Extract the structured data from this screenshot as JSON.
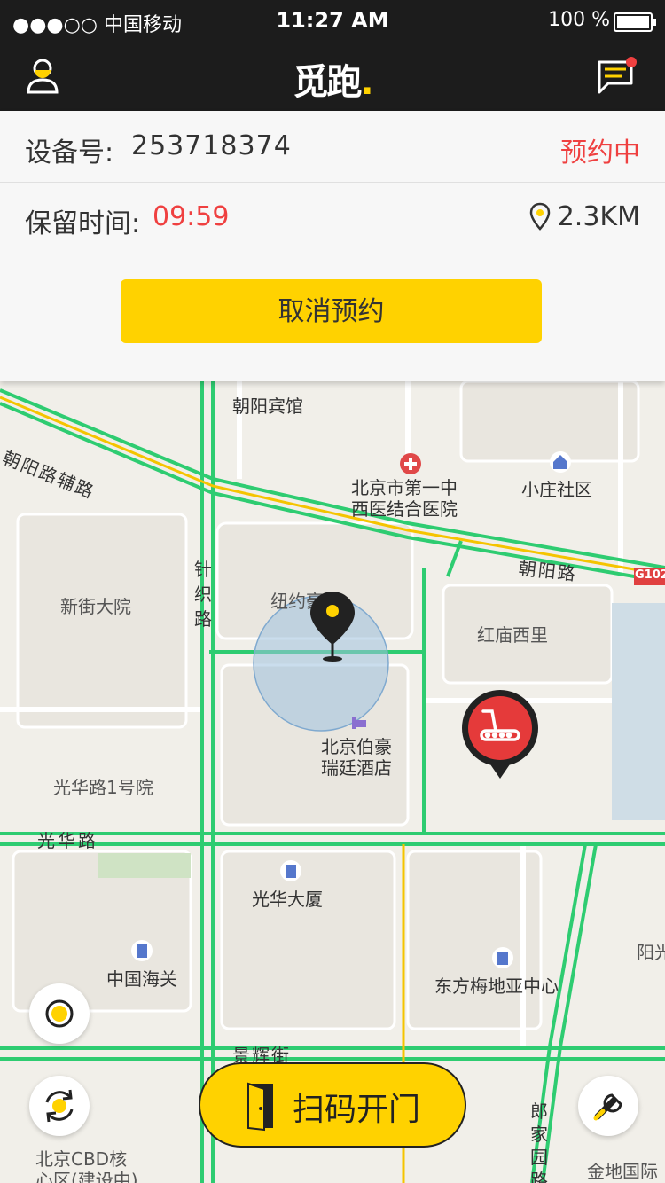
{
  "status_bar": {
    "carrier": "●●●○○ 中国移动",
    "time": "11:27 AM",
    "battery": "100 %",
    "battery_level": 1.0
  },
  "nav": {
    "logo_text": "觅跑",
    "logo_dot": "."
  },
  "reservation": {
    "device_label": "设备号:",
    "device_number": "253718374",
    "status": "预约中",
    "hold_label": "保留时间:",
    "hold_time": "09:59",
    "distance": "2.3KM",
    "cancel_button": "取消预约"
  },
  "map": {
    "pois": {
      "chaoyang_hotel": "朝阳宾馆",
      "chaoyang_fulu": "朝阳路辅路",
      "hospital": "北京市第一中西医结合医院",
      "hospital_l1": "北京市第一中",
      "hospital_l2": "西医结合医院",
      "xiaozhuang": "小庄社区",
      "chaoyang_road": "朝阳路",
      "g102": "G102",
      "zhenzhi_road": "针织路",
      "xinjie": "新街大院",
      "niuyue": "纽约豪园",
      "honglin": "红庙西里",
      "hotel_l1": "北京伯豪",
      "hotel_l2": "瑞廷酒店",
      "guanghua1": "光华路1号院",
      "guanghua_road": "光华路",
      "guanghua_tower": "光华大厦",
      "customs": "中国海关",
      "dongfang": "东方梅地亚中心",
      "yang": "阳光",
      "jinghui": "景辉街",
      "langjia": "郎家园路",
      "cbd_l1": "北京CBD核",
      "cbd_l2": "心区(建设中)",
      "jindi": "金地国际"
    }
  },
  "scan_button": "扫码开门",
  "colors": {
    "accent": "#ffd200",
    "alert": "#ef4040",
    "header": "#1c1c1c",
    "road_green": "#2ecc71"
  }
}
